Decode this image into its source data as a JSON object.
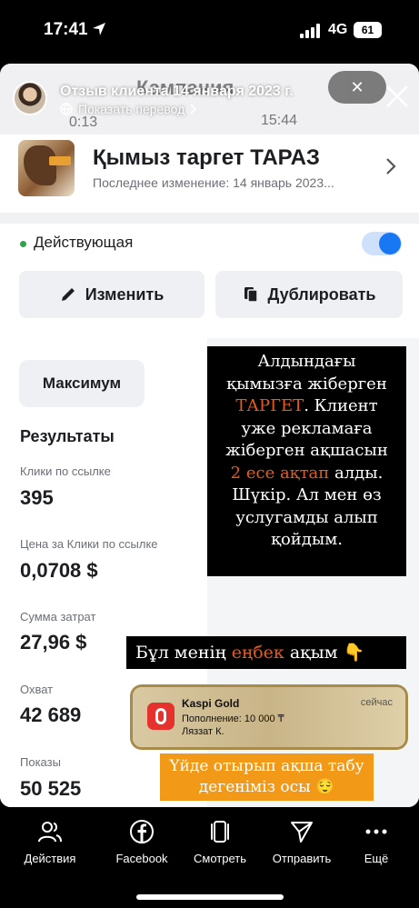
{
  "status_bar": {
    "time": "17:41",
    "network": "4G",
    "battery": "61"
  },
  "story": {
    "title": "Отзыв клиента 14 января 2023 г.",
    "translate": "Показать перевод"
  },
  "background_ui": {
    "ghost_title": "Кампания",
    "ghost_left_time": "0:13",
    "ghost_right_time": "15:44",
    "ghost_pill": "✕"
  },
  "campaign": {
    "name": "Қымыз таргет ТАРАЗ",
    "subtitle": "Последнее изменение: 14 январь 2023...",
    "status": "Действующая",
    "edit_label": "Изменить",
    "duplicate_label": "Дублировать"
  },
  "results": {
    "max_button": "Максимум",
    "heading": "Результаты",
    "metrics": [
      {
        "label": "Клики по ссылке",
        "value": "395"
      },
      {
        "label": "Цена за Клики по ссылке",
        "value": "0,0708 $"
      },
      {
        "label": "Сумма затрат",
        "value": "27,96 $"
      },
      {
        "label": "Охват",
        "value": "42 689"
      },
      {
        "label": "Показы",
        "value": "50 525"
      }
    ]
  },
  "overlay_card": {
    "line1": "Алдындағы",
    "line2": "қымызға жіберген",
    "line3_hl": "ТАРГЕТ",
    "line3_rest": ". Клиент",
    "line4": "уже рекламаға",
    "line5": "жіберген ақшасын",
    "line6_hl": "2 есе ақтап",
    "line6_rest": " алды.",
    "line7": "Шүкір. Ал мен өз",
    "line8": "услугамды алып",
    "line9": "қойдым."
  },
  "overlay_strip": {
    "pre": "Бұл менің ",
    "hl": "еңбек",
    "post": " ақым 👇"
  },
  "kaspi": {
    "app": "Kaspi Gold",
    "line1": "Пополнение: 10 000 ₸",
    "line2": "Ляззат К.",
    "when": "сейчас"
  },
  "overlay_orange": {
    "line1": "Үйде отырып ақша табу",
    "line2": "дегеніміз осы 😌"
  },
  "bottom_nav": [
    {
      "label": "Действия"
    },
    {
      "label": "Facebook"
    },
    {
      "label": "Смотреть"
    },
    {
      "label": "Отправить"
    },
    {
      "label": "Ещё"
    }
  ],
  "colors": {
    "accent": "#1877f2",
    "status_active": "#31a24c",
    "highlight": "#e85a1c",
    "orange_box": "#f29a18"
  }
}
